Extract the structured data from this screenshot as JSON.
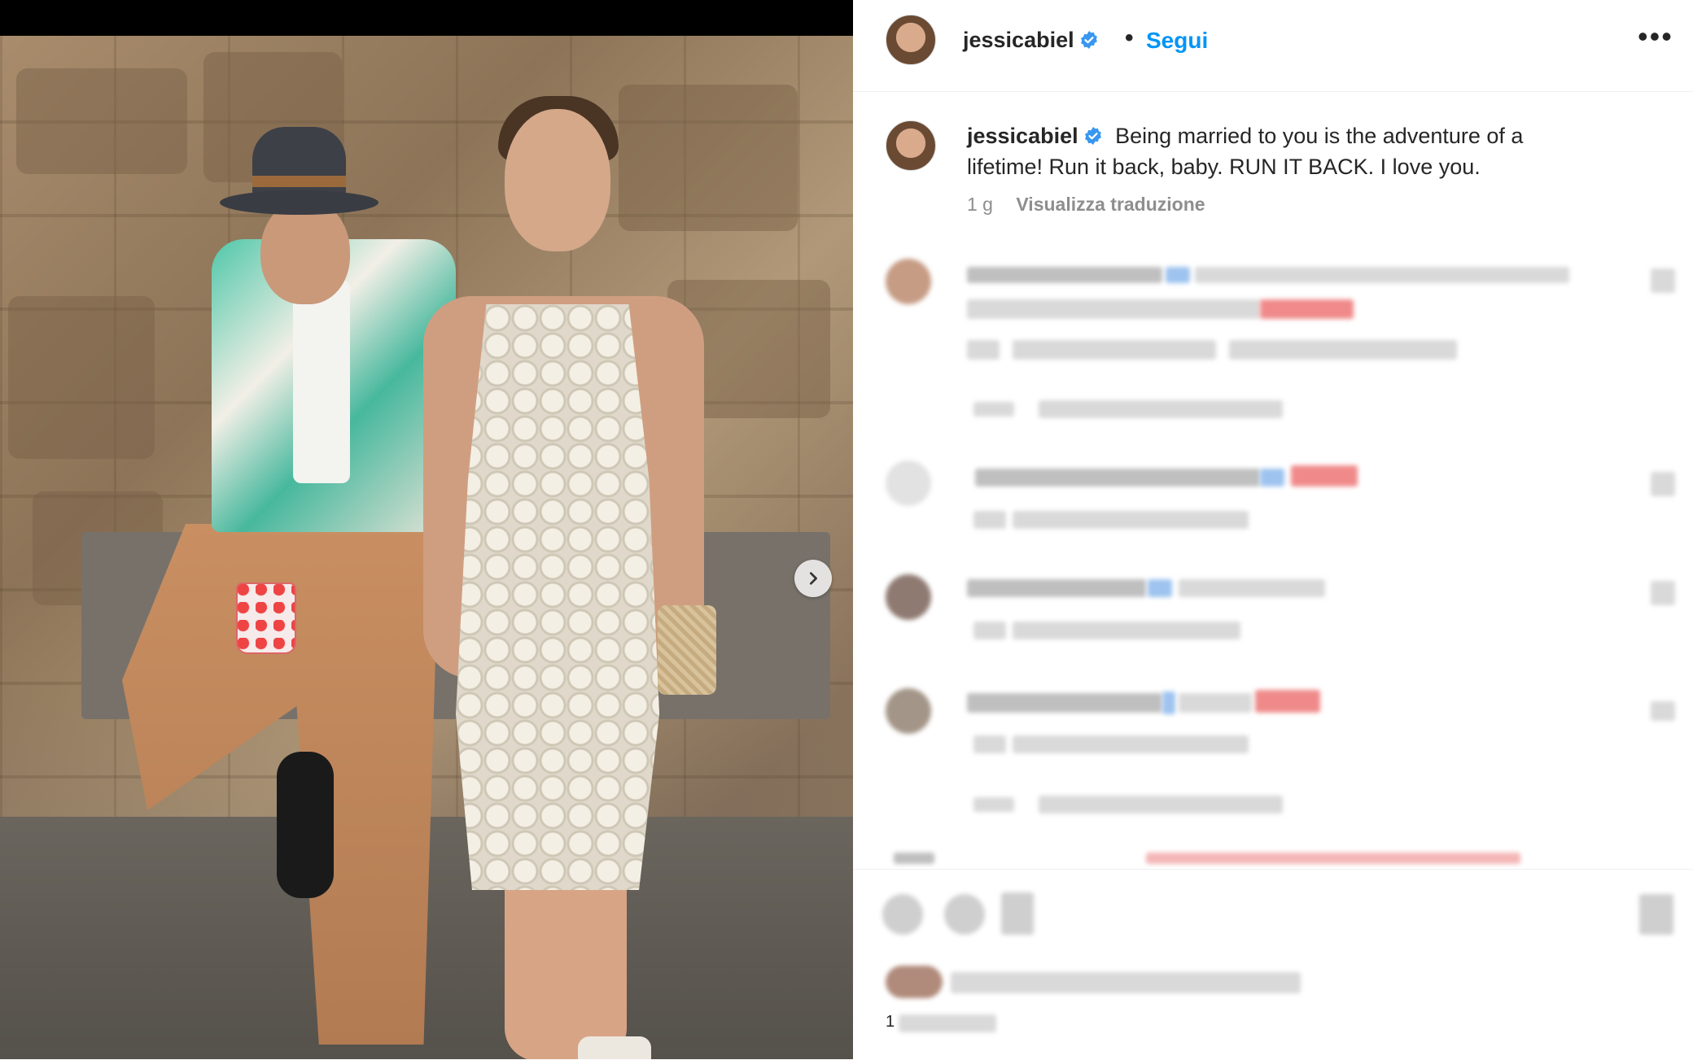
{
  "post": {
    "author": "jessicabiel",
    "follow_label": "Segui",
    "separator": "•",
    "more_label": "•••",
    "caption": "Being married to you is the adventure of a lifetime! Run it back, baby. RUN IT BACK. I love you.",
    "time": "1 g",
    "translate_label": "Visualizza traduzione",
    "likes_prefix": "1"
  },
  "colors": {
    "accent": "#0095f6",
    "verified": "#3897f0"
  },
  "icons": {
    "verified": "verified-badge-icon",
    "next": "chevron-right-icon",
    "more": "more-options-icon"
  }
}
